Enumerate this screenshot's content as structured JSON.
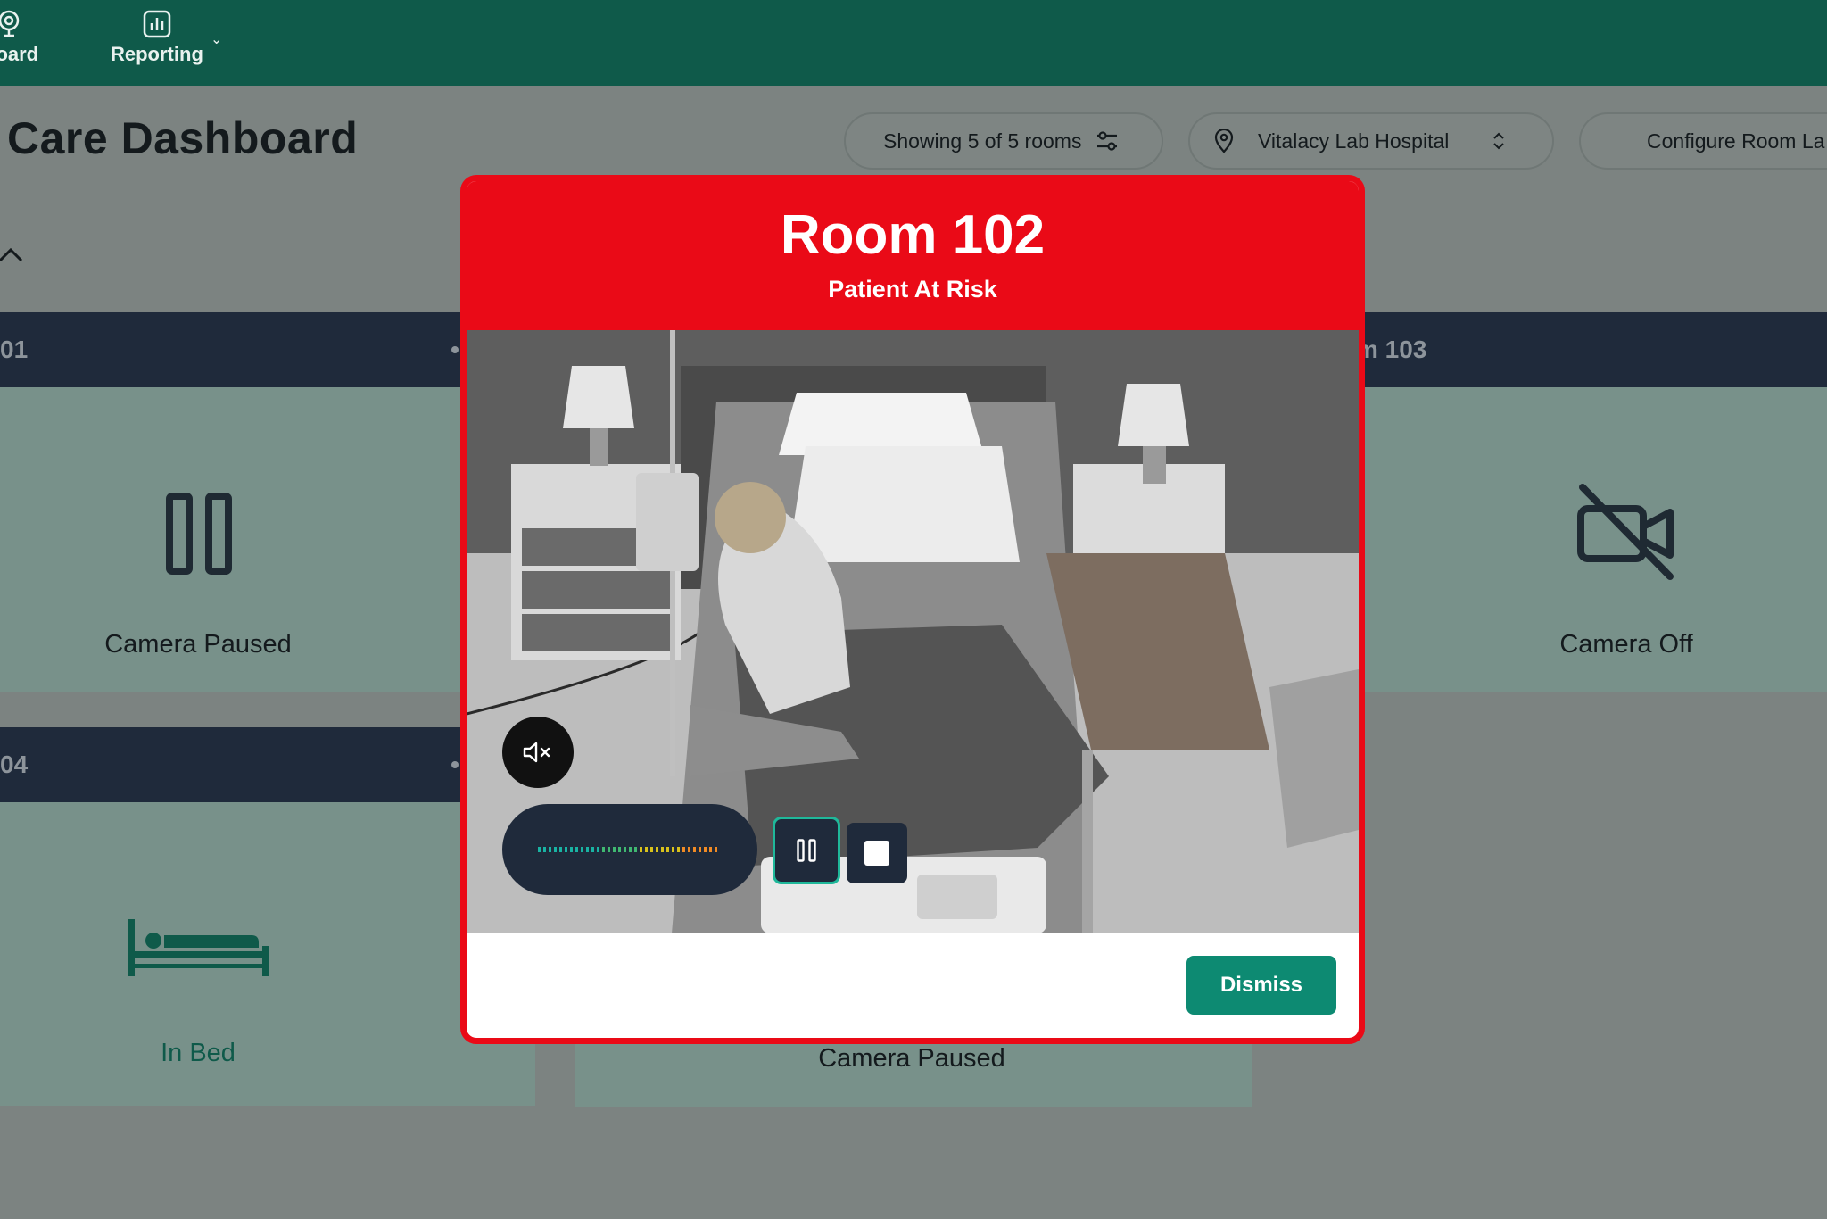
{
  "nav": {
    "items": [
      {
        "label": "board",
        "icon": "camera-icon"
      },
      {
        "label": "Reporting",
        "icon": "bar-chart-icon"
      }
    ]
  },
  "page": {
    "title": "Care Dashboard"
  },
  "filters": {
    "rooms_label": "Showing 5 of 5 rooms",
    "hospital": "Vitalacy Lab Hospital",
    "configure_label": "Configure Room La"
  },
  "rooms": {
    "room_101": {
      "header": "01",
      "status": "Camera Paused"
    },
    "room_103": {
      "header": "m 103",
      "status": "Camera Off"
    },
    "room_104": {
      "header": "04",
      "status": "In Bed"
    },
    "room_105": {
      "status": "Camera Paused"
    }
  },
  "alert": {
    "title": "Room 102",
    "subtitle": "Patient At Risk",
    "dismiss_label": "Dismiss"
  },
  "colors": {
    "topbar": "#0f5a4a",
    "alert_red": "#ea0a17",
    "primary_teal": "#0d8a72",
    "navy": "#1f2a3b"
  }
}
